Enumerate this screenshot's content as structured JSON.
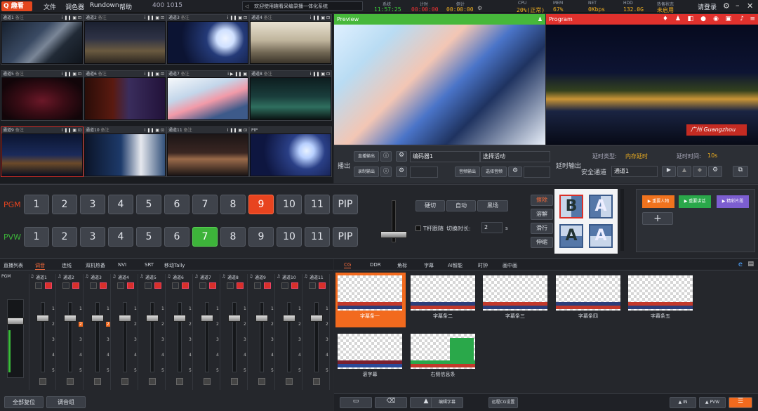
{
  "topbar": {
    "logo": "Q 趣看",
    "menus": [
      "文件",
      "调色器",
      "Rundown",
      "帮助"
    ],
    "resolution": "400  1015",
    "notice": "欢迎使用趣看采编录播一体化系统",
    "stats": [
      {
        "label": "系统",
        "value": "11:57:25"
      },
      {
        "label": "计时",
        "value": "00:00:00"
      },
      {
        "label": "倒计",
        "value": "00:00:00"
      },
      {
        "label": "CPU",
        "value": "20%(正常)"
      },
      {
        "label": "MEM",
        "value": "67%"
      },
      {
        "label": "NET",
        "value": "0Kbps"
      },
      {
        "label": "HDD",
        "value": "132.0G"
      },
      {
        "label": "热备状态",
        "value": "未启用"
      }
    ],
    "login": "请登录"
  },
  "sources": [
    {
      "name": "通道1",
      "sub": "备注"
    },
    {
      "name": "通道2",
      "sub": "备注"
    },
    {
      "name": "通道3",
      "sub": "备注"
    },
    {
      "name": "通道4",
      "sub": "备注"
    },
    {
      "name": "通道5",
      "sub": "备注"
    },
    {
      "name": "通道6",
      "sub": "备注"
    },
    {
      "name": "通道7",
      "sub": "备注"
    },
    {
      "name": "通道8",
      "sub": "备注"
    },
    {
      "name": "通道9",
      "sub": "备注"
    },
    {
      "name": "通道10",
      "sub": "备注"
    },
    {
      "name": "通道11",
      "sub": "备注"
    },
    {
      "name": "PIP",
      "sub": ""
    }
  ],
  "preview": {
    "title": "Preview"
  },
  "program": {
    "title": "Program",
    "caption": "广州 Guangzhou"
  },
  "output": {
    "section_label": "播出",
    "live_label": "直播输出",
    "record_label": "录制输出",
    "encoder": "编码器1",
    "activity": "选择活动",
    "audio_out": "音频输出",
    "select_audio": "选择音频",
    "delay_label": "延时输出",
    "safe_channel": "安全通道",
    "channel": "通道1",
    "delay_type_label": "延时类型:",
    "delay_type_value": "内存延时",
    "delay_time_label": "延时时间:",
    "delay_time_value": "10s"
  },
  "switcher": {
    "pgm_label": "PGM",
    "pvw_label": "PVW",
    "buttons": [
      "1",
      "2",
      "3",
      "4",
      "5",
      "6",
      "7",
      "8",
      "9",
      "10",
      "11",
      "PIP"
    ],
    "pgm_active": "9",
    "pvw_active": "7"
  },
  "transition": {
    "hard_cut": "硬切",
    "auto": "自动",
    "black": "黑场",
    "tbar_follow": "T杆跟随",
    "duration_label": "切换时长:",
    "duration_value": "2",
    "duration_unit": "s",
    "effects": [
      "擦除",
      "溶解",
      "滑行",
      "伸缩"
    ]
  },
  "overlays": {
    "b1": "重要人物",
    "b2": "重要讲话",
    "b3": "精彩片段",
    "add": "+"
  },
  "left_tabs": [
    "直播列表",
    "调音",
    "连线",
    "双机热备",
    "NVI",
    "SRT",
    "移动Tally"
  ],
  "mixer": {
    "pgm_label": "PGM",
    "channels": [
      "通道1",
      "通道2",
      "通道3",
      "通道4",
      "通道5",
      "通道6",
      "通道7",
      "通道8",
      "通道9",
      "通道10",
      "通道11"
    ],
    "reset": "全部复位",
    "group": "调音组"
  },
  "right_tabs": [
    "CG",
    "DDR",
    "角标",
    "字幕",
    "AI智能",
    "时钟",
    "画中画"
  ],
  "cg_items": [
    "字幕条一",
    "字幕条二",
    "字幕条三",
    "字幕条四",
    "字幕条五",
    "滚字幕",
    "右侧信息条"
  ],
  "bottom_bar": {
    "edit_sub": "编辑字幕",
    "remote_cg": "远程CG设置",
    "in": "IN",
    "pvw": "PVW"
  }
}
